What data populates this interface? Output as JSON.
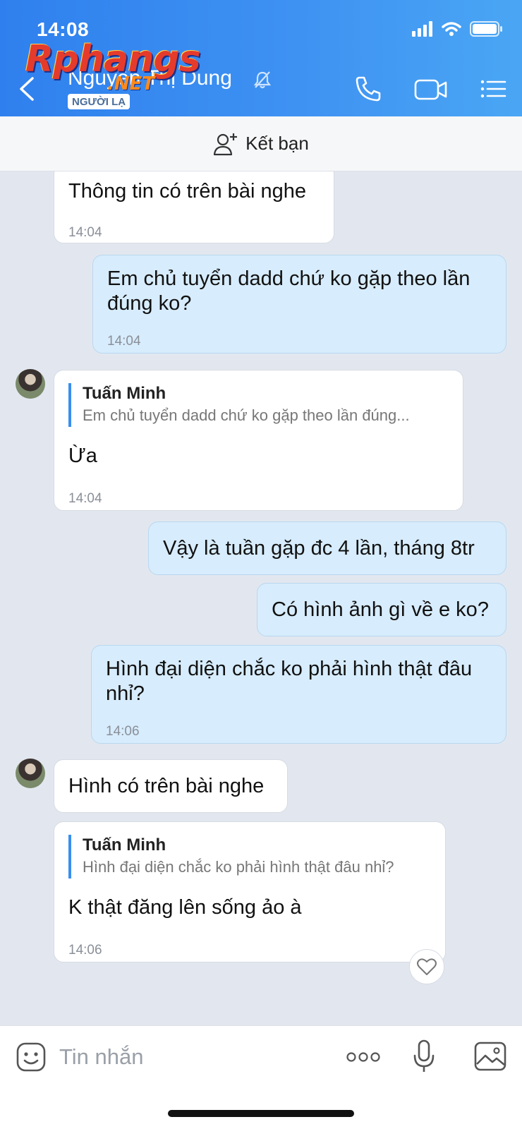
{
  "status_bar": {
    "time": "14:08"
  },
  "header": {
    "title": "Nguyễn Thị Dung",
    "badge": "NGƯỜI LẠ",
    "watermark_main": "Rphangs",
    "watermark_sub": ".NET",
    "icons": [
      "back-icon",
      "mute-bell-icon",
      "phone-icon",
      "video-call-icon",
      "menu-list-icon"
    ]
  },
  "add_friend": {
    "label": "Kết bạn"
  },
  "messages": [
    {
      "dir": "in",
      "text": "Thông tin có trên bài nghe",
      "time": "14:04"
    },
    {
      "dir": "out",
      "text": "Em chủ tuyển dadd chứ ko gặp theo lần đúng ko?",
      "time": "14:04"
    },
    {
      "dir": "in",
      "quote_name": "Tuấn Minh",
      "quote_text": "Em chủ tuyển dadd chứ ko gặp theo lần đúng...",
      "text": "Ừa",
      "time": "14:04"
    },
    {
      "dir": "out",
      "text": "Vậy là tuần gặp đc 4 lần, tháng 8tr"
    },
    {
      "dir": "out",
      "text": "Có hình ảnh gì về e ko?"
    },
    {
      "dir": "out",
      "text": "Hình đại diện chắc ko phải hình thật đâu nhỉ?",
      "time": "14:06"
    },
    {
      "dir": "in",
      "text": "Hình có trên bài nghe"
    },
    {
      "dir": "in",
      "quote_name": "Tuấn Minh",
      "quote_text": "Hình đại diện chắc ko phải hình thật đâu nhỉ?",
      "text": "K thật đăng lên sống ảo à",
      "time": "14:06"
    }
  ],
  "composer": {
    "placeholder": "Tin nhắn"
  },
  "colors": {
    "header_start": "#2f80ee",
    "header_end": "#4aa6f4",
    "outgoing": "#d7ecfc",
    "incoming": "#ffffff",
    "quote_bar": "#3a8ef0"
  }
}
